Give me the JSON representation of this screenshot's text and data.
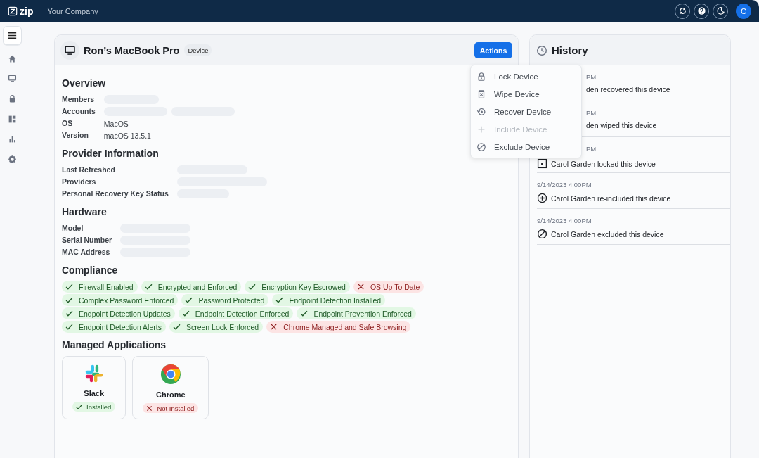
{
  "topbar": {
    "logo": "zip",
    "company": "Your Company",
    "avatar": "C"
  },
  "device": {
    "title": "Ron’s MacBook Pro",
    "badge": "Device",
    "actions_button": "Actions",
    "sections": [
      {
        "title": "Overview",
        "fields": [
          {
            "label": "Members",
            "kind": "loading"
          },
          {
            "label": "Accounts",
            "kind": "loading_pair"
          },
          {
            "label": "OS",
            "kind": "text",
            "value": "MacOS"
          },
          {
            "label": "Version",
            "kind": "text",
            "value": "macOS 13.5.1"
          }
        ]
      },
      {
        "title": "Provider Information",
        "fields": [
          {
            "label": "Last Refreshed",
            "kind": "loading"
          },
          {
            "label": "Providers",
            "kind": "loading"
          },
          {
            "label": "Personal Recovery Key Status",
            "kind": "loading"
          }
        ]
      },
      {
        "title": "Hardware",
        "fields": [
          {
            "label": "Model",
            "kind": "loading"
          },
          {
            "label": "Serial Number",
            "kind": "loading"
          },
          {
            "label": "MAC Address",
            "kind": "loading"
          }
        ]
      }
    ],
    "compliance": {
      "title": "Compliance",
      "checks": [
        {
          "label": "Firewall Enabled",
          "passed": true
        },
        {
          "label": "Encrypted and Enforced",
          "passed": true
        },
        {
          "label": "Encryption Key Escrowed",
          "passed": true
        },
        {
          "label": "OS Up To Date",
          "passed": false
        },
        {
          "label": "Complex Password Enforced",
          "passed": true
        },
        {
          "label": "Password Protected",
          "passed": true
        },
        {
          "label": "Endpoint Detection Installed",
          "passed": true
        },
        {
          "label": "Endpoint Detection Updates",
          "passed": true
        },
        {
          "label": "Endpoint Detection Enforced",
          "passed": true
        },
        {
          "label": "Endpoint Prevention Enforced",
          "passed": true
        },
        {
          "label": "Endpoint Detection Alerts",
          "passed": true
        },
        {
          "label": "Screen Lock Enforced",
          "passed": true
        },
        {
          "label": "Chrome Managed and Safe Browsing",
          "passed": false
        }
      ]
    },
    "applications": {
      "title": "Managed Applications",
      "apps": [
        {
          "name": "Slack",
          "status": "Installed",
          "installed": true
        },
        {
          "name": "Chrome",
          "status": "Not Installed",
          "installed": false
        }
      ]
    }
  },
  "actions_menu": {
    "items": [
      {
        "label": "Lock Device",
        "disabled": false
      },
      {
        "label": "Wipe Device",
        "disabled": false
      },
      {
        "label": "Recover Device",
        "disabled": false
      },
      {
        "label": "Include Device",
        "disabled": true
      },
      {
        "label": "Exclude Device",
        "disabled": false
      }
    ]
  },
  "history": {
    "title": "History",
    "entries": [
      {
        "kind": "partial",
        "time": "PM",
        "text": "den recovered this device"
      },
      {
        "kind": "partial",
        "time": "PM",
        "text": "den wiped this device"
      },
      {
        "kind": "time_partial",
        "time": "PM",
        "text": "Carol Garden locked this device"
      },
      {
        "kind": "full",
        "time": "9/14/2023 4:00PM",
        "text": "Carol Garden re-included this device"
      },
      {
        "kind": "full",
        "time": "9/14/2023 4:00PM",
        "text": "Carol Garden excluded this device"
      }
    ]
  }
}
